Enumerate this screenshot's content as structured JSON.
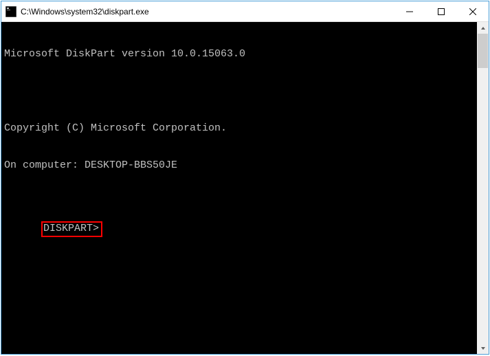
{
  "window": {
    "title": "C:\\Windows\\system32\\diskpart.exe"
  },
  "console": {
    "line1": "Microsoft DiskPart version 10.0.15063.0",
    "line2": "Copyright (C) Microsoft Corporation.",
    "line3": "On computer: DESKTOP-BBS50JE",
    "prompt": "DISKPART>"
  }
}
